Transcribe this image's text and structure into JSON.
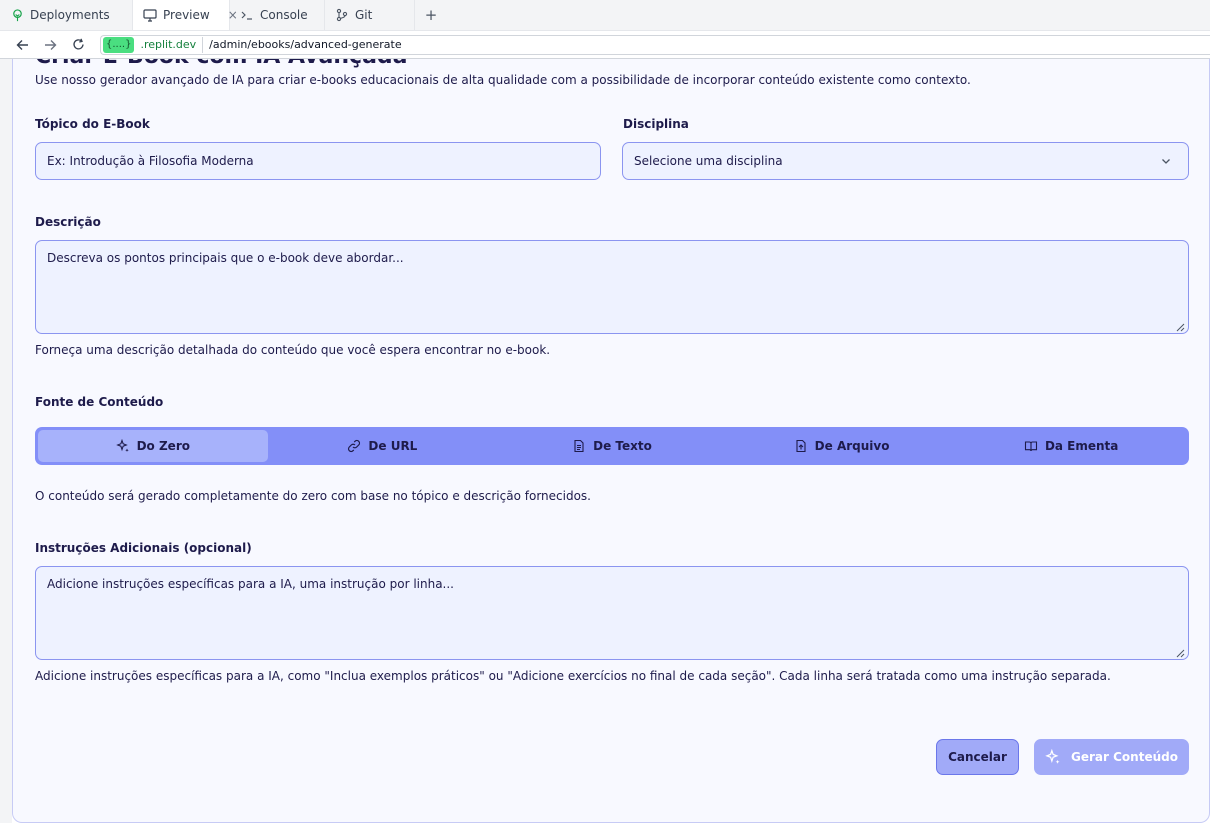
{
  "browser": {
    "tabs": [
      {
        "label": "Deployments",
        "icon": "deployments-icon"
      },
      {
        "label": "Preview",
        "icon": "monitor-icon",
        "close": "×"
      },
      {
        "label": "Console",
        "icon": "terminal-icon"
      },
      {
        "label": "Git",
        "icon": "git-icon"
      }
    ],
    "add_tab": "+",
    "url_badge": "{....}",
    "url_domain": ".replit.dev",
    "url_path": "/admin/ebooks/advanced-generate"
  },
  "page": {
    "heading": "Criar E-Book com IA Avançada",
    "intro": "Use nosso gerador avançado de IA para criar e-books educacionais de alta qualidade com a possibilidade de incorporar conteúdo existente como contexto.",
    "topic_label": "Tópico do E-Book",
    "topic_placeholder": "Ex: Introdução à Filosofia Moderna",
    "discipline_label": "Disciplina",
    "discipline_value": "Selecione uma disciplina",
    "description_label": "Descrição",
    "description_placeholder": "Descreva os pontos principais que o e-book deve abordar...",
    "description_hint": "Forneça uma descrição detalhada do conteúdo que você espera encontrar no e-book.",
    "source_label": "Fonte de Conteúdo",
    "source_tabs": [
      "Do Zero",
      "De URL",
      "De Texto",
      "De Arquivo",
      "Da Ementa"
    ],
    "source_hint": "O conteúdo será gerado completamente do zero com base no tópico e descrição fornecidos.",
    "instructions_label": "Instruções Adicionais (opcional)",
    "instructions_placeholder": "Adicione instruções específicas para a IA, uma instrução por linha...",
    "instructions_hint": "Adicione instruções específicas para a IA, como \"Inclua exemplos práticos\" ou \"Adicione exercícios no final de cada seção\". Cada linha será tratada como uma instrução separada.",
    "cancel_label": "Cancelar",
    "generate_label": "Gerar Conteúdo"
  },
  "colors": {
    "accent": "#838ff8",
    "accent_light": "#a7b2fb",
    "input_bg": "#eef2ff",
    "text": "#1e1b4b"
  }
}
